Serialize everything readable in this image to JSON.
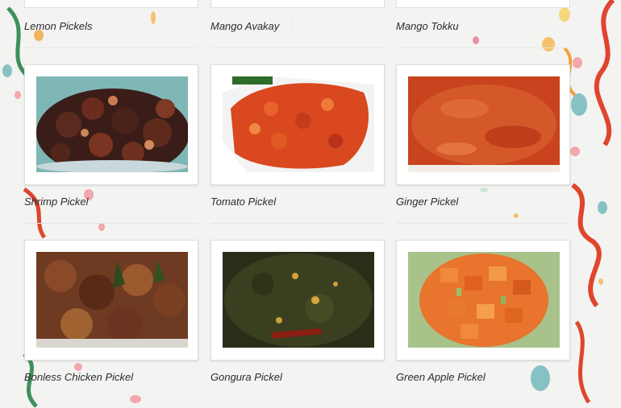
{
  "grid": {
    "rows": [
      [
        "Lemon Pickels",
        "Mango Avakay",
        "Mango Tokku"
      ],
      [
        "Shrimp Pickel",
        "Tomato Pickel",
        "Ginger Pickel"
      ],
      [
        "Bonless Chicken Pickel",
        "Gongura Pickel",
        "Green Apple Pickel"
      ]
    ]
  },
  "items": {
    "lemon": "Lemon Pickels",
    "mango_avakay": "Mango Avakay",
    "mango_tokku": "Mango Tokku",
    "shrimp": "Shrimp Pickel",
    "tomato": "Tomato Pickel",
    "ginger": "Ginger Pickel",
    "chicken": "Bonless Chicken Pickel",
    "gongura": "Gongura Pickel",
    "green_apple": "Green Apple Pickel"
  },
  "colors": {
    "background": "#f3f3f2",
    "card": "#ffffff",
    "ribbon_green": "#3f8f5c",
    "ribbon_red": "#e0452d",
    "ribbon_orange": "#f0a23a"
  }
}
